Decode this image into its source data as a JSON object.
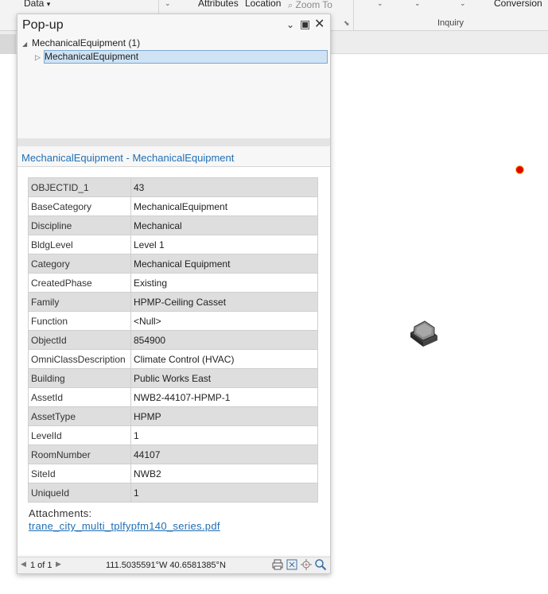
{
  "ribbon": {
    "data_label": "Data",
    "attributes_label": "Attributes",
    "location_label": "Location",
    "zoom_to_label": "Zoom To",
    "conversion_label": "Conversion",
    "inquiry_group": "Inquiry"
  },
  "popup": {
    "title": "Pop-up",
    "tree": {
      "root_label": "MechanicalEquipment (1)",
      "child_label": "MechanicalEquipment"
    },
    "feature_title": "MechanicalEquipment - MechanicalEquipment",
    "attributes": [
      {
        "key": "OBJECTID_1",
        "value": "43"
      },
      {
        "key": "BaseCategory",
        "value": "MechanicalEquipment"
      },
      {
        "key": "Discipline",
        "value": "Mechanical"
      },
      {
        "key": "BldgLevel",
        "value": "Level 1"
      },
      {
        "key": "Category",
        "value": "Mechanical Equipment"
      },
      {
        "key": "CreatedPhase",
        "value": "Existing"
      },
      {
        "key": "Family",
        "value": "HPMP-Ceiling Casset"
      },
      {
        "key": "Function",
        "value": "<Null>"
      },
      {
        "key": "ObjectId",
        "value": "854900"
      },
      {
        "key": "OmniClassDescription",
        "value": "Climate Control (HVAC)"
      },
      {
        "key": "Building",
        "value": "Public Works East"
      },
      {
        "key": "AssetId",
        "value": "NWB2-44107-HPMP-1"
      },
      {
        "key": "AssetType",
        "value": "HPMP"
      },
      {
        "key": "LevelId",
        "value": "1"
      },
      {
        "key": "RoomNumber",
        "value": "44107"
      },
      {
        "key": "SiteId",
        "value": "NWB2"
      },
      {
        "key": "UniqueId",
        "value": "1"
      }
    ],
    "attachments_label": "Attachments:",
    "attachment_file": "trane_city_multi_tplfypfm140_series.pdf",
    "status": {
      "page": "1 of 1",
      "coordinates": "111.5035591°W 40.6581385°N"
    }
  },
  "colors": {
    "link": "#1f6fb4",
    "selection": "#cfe3f4",
    "point_marker": "#e60000"
  }
}
